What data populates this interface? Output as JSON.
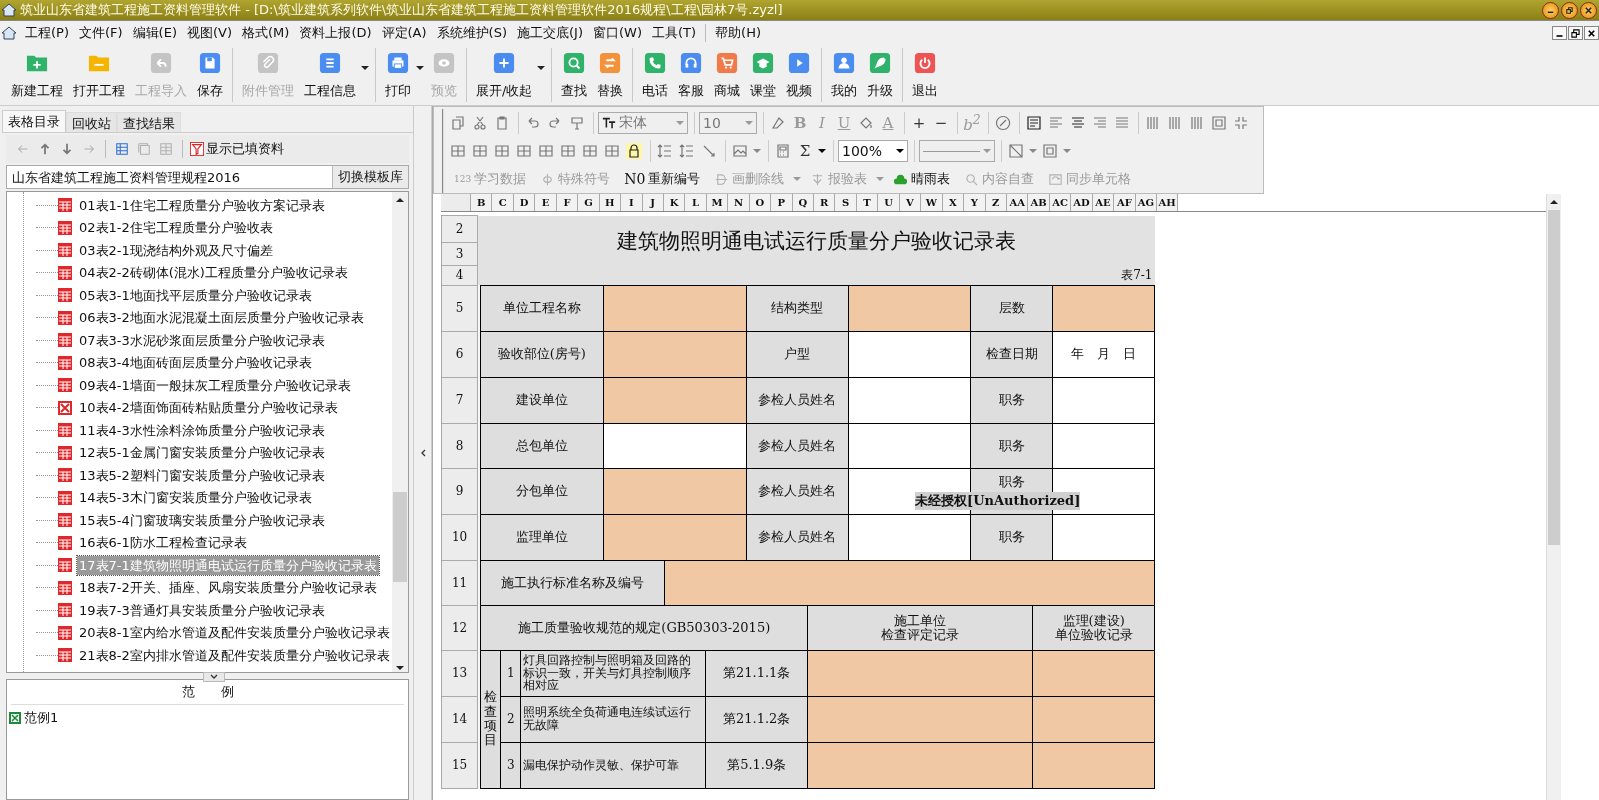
{
  "window": {
    "title": "筑业山东省建筑工程施工资料管理软件 - [D:\\筑业建筑系列软件\\筑业山东省建筑工程施工资料管理软件2016规程\\工程\\园林7号.zyzl]"
  },
  "menu": [
    "工程(P)",
    "文件(F)",
    "编辑(E)",
    "视图(V)",
    "格式(M)",
    "资料上报(D)",
    "评定(A)",
    "系统维护(S)",
    "施工交底(J)",
    "窗口(W)",
    "工具(T)"
  ],
  "help_menu": "帮助(H)",
  "toolbar": [
    [
      {
        "label": "新建工程",
        "kind": "new",
        "disabled": false,
        "dropdown": false
      },
      {
        "label": "打开工程",
        "kind": "open",
        "disabled": false,
        "dropdown": false
      },
      {
        "label": "工程导入",
        "kind": "import",
        "disabled": true,
        "dropdown": false
      },
      {
        "label": "保存",
        "kind": "save",
        "disabled": false,
        "dropdown": false
      }
    ],
    [
      {
        "label": "附件管理",
        "kind": "attach",
        "disabled": true,
        "dropdown": false
      },
      {
        "label": "工程信息",
        "kind": "info",
        "disabled": false,
        "dropdown": true
      }
    ],
    [
      {
        "label": "打印",
        "kind": "print",
        "disabled": false,
        "dropdown": true
      },
      {
        "label": "预览",
        "kind": "preview",
        "disabled": true,
        "dropdown": false
      }
    ],
    [
      {
        "label": "展开/收起",
        "kind": "expand",
        "disabled": false,
        "dropdown": true
      }
    ],
    [
      {
        "label": "查找",
        "kind": "find",
        "disabled": false,
        "dropdown": false
      },
      {
        "label": "替换",
        "kind": "replace",
        "disabled": false,
        "dropdown": false
      }
    ],
    [
      {
        "label": "电话",
        "kind": "phone",
        "disabled": false,
        "dropdown": false
      },
      {
        "label": "客服",
        "kind": "service",
        "disabled": false,
        "dropdown": false
      },
      {
        "label": "商城",
        "kind": "shop",
        "disabled": false,
        "dropdown": false
      },
      {
        "label": "课堂",
        "kind": "class",
        "disabled": false,
        "dropdown": false
      },
      {
        "label": "视频",
        "kind": "video",
        "disabled": false,
        "dropdown": false
      }
    ],
    [
      {
        "label": "我的",
        "kind": "me",
        "disabled": false,
        "dropdown": false
      },
      {
        "label": "升级",
        "kind": "upgrade",
        "disabled": false,
        "dropdown": false
      }
    ],
    [
      {
        "label": "退出",
        "kind": "exit",
        "disabled": false,
        "dropdown": false
      }
    ]
  ],
  "left_panel": {
    "tabs": [
      {
        "label": "表格目录",
        "selected": true
      },
      {
        "label": "回收站",
        "selected": false
      },
      {
        "label": "查找结果",
        "selected": false
      }
    ],
    "tree_toolbar": [
      {
        "disabled": true
      },
      {
        "disabled": false
      },
      {
        "disabled": false
      },
      {
        "disabled": true
      },
      {
        "disabled": false
      },
      {
        "disabled": true
      },
      {
        "disabled": true
      }
    ],
    "filter_button": "显示已填资料",
    "library": "山东省建筑工程施工资料管理规程2016",
    "switch_button": "切换模板库",
    "tree": [
      {
        "label": "01表1-1住宅工程质量分户验收方案记录表",
        "kind": "table",
        "selected": false
      },
      {
        "label": "02表1-2住宅工程质量分户验收表",
        "kind": "table",
        "selected": false
      },
      {
        "label": "03表2-1现浇结构外观及尺寸偏差",
        "kind": "table",
        "selected": false
      },
      {
        "label": "04表2-2砖砌体(混水)工程质量分户验收记录表",
        "kind": "table",
        "selected": false
      },
      {
        "label": "05表3-1地面找平层质量分户验收记录表",
        "kind": "table",
        "selected": false
      },
      {
        "label": "06表3-2地面水泥混凝土面层质量分户验收记录表",
        "kind": "table",
        "selected": false
      },
      {
        "label": "07表3-3水泥砂浆面层质量分户验收记录表",
        "kind": "table",
        "selected": false
      },
      {
        "label": "08表3-4地面砖面层质量分户验收记录表",
        "kind": "table",
        "selected": false
      },
      {
        "label": "09表4-1墙面一般抹灰工程质量分户验收记录表",
        "kind": "table",
        "selected": false
      },
      {
        "label": "10表4-2墙面饰面砖粘贴质量分户验收记录表",
        "kind": "error",
        "selected": false
      },
      {
        "label": "11表4-3水性涂料涂饰质量分户验收记录表",
        "kind": "table",
        "selected": false
      },
      {
        "label": "12表5-1金属门窗安装质量分户验收记录表",
        "kind": "table",
        "selected": false
      },
      {
        "label": "13表5-2塑料门窗安装质量分户验收记录表",
        "kind": "table",
        "selected": false
      },
      {
        "label": "14表5-3木门窗安装质量分户验收记录表",
        "kind": "table",
        "selected": false
      },
      {
        "label": "15表5-4门窗玻璃安装质量分户验收记录表",
        "kind": "table",
        "selected": false
      },
      {
        "label": "16表6-1防水工程检查记录表",
        "kind": "table",
        "selected": false
      },
      {
        "label": "17表7-1建筑物照明通电试运行质量分户验收记录表",
        "kind": "table",
        "selected": true
      },
      {
        "label": "18表7-2开关、插座、风扇安装质量分户验收记录表",
        "kind": "table",
        "selected": false
      },
      {
        "label": "19表7-3普通灯具安装质量分户验收记录表",
        "kind": "table",
        "selected": false
      },
      {
        "label": "20表8-1室内给水管道及配件安装质量分户验收记录表",
        "kind": "table",
        "selected": false
      },
      {
        "label": "21表8-2室内排水管道及配件安装质量分户验收记录表",
        "kind": "table",
        "selected": false
      }
    ],
    "example_header": "范　　例",
    "examples": [
      "范例1"
    ]
  },
  "format_toolbar": {
    "font": {
      "value": "宋体",
      "disabled": true
    },
    "size": {
      "value": "10",
      "disabled": true
    },
    "text_style": [
      {
        "text": "B",
        "disabled": true
      },
      {
        "text": "I",
        "disabled": true
      },
      {
        "text": "U",
        "disabled": true
      },
      {
        "text": "A",
        "disabled": true
      }
    ],
    "resize": [
      {
        "text": "+",
        "disabled": false
      },
      {
        "text": "−",
        "disabled": false
      }
    ],
    "superscript": {
      "text": "b$^{2}$",
      "disabled": true
    },
    "sum": {
      "text": "Σ",
      "disabled": false
    },
    "zoom": {
      "value": "100%",
      "disabled": false
    },
    "line_style": {
      "disabled": true
    },
    "tools": [
      {
        "label": "学习数据",
        "kind": "prefix",
        "prefix": "123",
        "disabled": true,
        "dropdown": false
      },
      {
        "label": "特殊符号",
        "kind": "icon",
        "disabled": true,
        "dropdown": false
      },
      {
        "label": "重新编号",
        "kind": "prefix",
        "prefix": "N0",
        "disabled": false,
        "dropdown": false
      },
      {
        "label": "画删除线",
        "kind": "icon",
        "disabled": true,
        "dropdown": true
      },
      {
        "label": "报验表",
        "kind": "icon",
        "disabled": true,
        "dropdown": true
      },
      {
        "label": "晴雨表",
        "kind": "icon",
        "disabled": false,
        "dropdown": false
      },
      {
        "label": "内容自查",
        "kind": "icon",
        "disabled": true,
        "dropdown": false
      },
      {
        "label": "同步单元格",
        "kind": "icon",
        "disabled": true,
        "dropdown": false
      }
    ]
  },
  "sheet": {
    "columns": [
      "B",
      "C",
      "D",
      "E",
      "F",
      "G",
      "H",
      "I",
      "J",
      "K",
      "L",
      "M",
      "N",
      "O",
      "P",
      "Q",
      "R",
      "S",
      "T",
      "U",
      "V",
      "W",
      "X",
      "Y",
      "Z",
      "AA",
      "AB",
      "AC",
      "AD",
      "AE",
      "AF",
      "AG",
      "AH"
    ],
    "rows": [
      "2",
      "3",
      "4",
      "5",
      "6",
      "7",
      "8",
      "9",
      "10",
      "11",
      "12",
      "13",
      "14",
      "15"
    ],
    "title": "建筑物照明通电试运行质量分户验收记录表",
    "form_no": "表7-1",
    "info_rows": [
      [
        {
          "text": "单位工程名称",
          "kind": "label"
        },
        {
          "kind": "input"
        },
        {
          "text": "结构类型",
          "kind": "label"
        },
        {
          "kind": "input"
        },
        {
          "text": "层数",
          "kind": "label"
        },
        {
          "kind": "input"
        }
      ],
      [
        {
          "text": "验收部位(房号)",
          "kind": "label"
        },
        {
          "kind": "input"
        },
        {
          "text": "户型",
          "kind": "label"
        },
        {
          "kind": "blank"
        },
        {
          "text": "检查日期",
          "kind": "label"
        },
        {
          "text": "年　月　日",
          "kind": "blank"
        }
      ],
      [
        {
          "text": "建设单位",
          "kind": "label"
        },
        {
          "kind": "input"
        },
        {
          "text": "参检人员姓名",
          "kind": "label"
        },
        {
          "kind": "blank"
        },
        {
          "text": "职务",
          "kind": "label"
        },
        {
          "kind": "blank"
        }
      ],
      [
        {
          "text": "总包单位",
          "kind": "label"
        },
        {
          "kind": "blank"
        },
        {
          "text": "参检人员姓名",
          "kind": "label"
        },
        {
          "kind": "blank"
        },
        {
          "text": "职务",
          "kind": "label"
        },
        {
          "kind": "blank"
        }
      ],
      [
        {
          "text": "分包单位",
          "kind": "label"
        },
        {
          "kind": "input"
        },
        {
          "text": "参检人员姓名",
          "kind": "label"
        },
        {
          "kind": "blank"
        },
        {
          "text": "职务",
          "kind": "label"
        },
        {
          "kind": "blank"
        }
      ],
      [
        {
          "text": "监理单位",
          "kind": "label"
        },
        {
          "kind": "input"
        },
        {
          "text": "参检人员姓名",
          "kind": "label"
        },
        {
          "kind": "blank"
        },
        {
          "text": "职务",
          "kind": "label"
        },
        {
          "kind": "blank"
        }
      ]
    ],
    "standard": "施工执行标准名称及编号",
    "header": [
      "施工质量验收规范的规定(GB50303-2015)",
      [
        "施工单位",
        "检查评定记录"
      ],
      [
        "监理(建设)",
        "单位验收记录"
      ]
    ],
    "group": "检查项目",
    "items": [
      {
        "no": "1",
        "text": "灯具回路控制与照明箱及回路的标识一致，开关与灯具控制顺序相对应",
        "clause": "第21.1.1条"
      },
      {
        "no": "2",
        "text": "照明系统全负荷通电连续试运行无故障",
        "clause": "第21.1.2条"
      },
      {
        "no": "3",
        "text": "漏电保护动作灵敏、保护可靠",
        "clause": "第5.1.9条"
      }
    ],
    "overlay": "未经授权[UnAuthorized]"
  }
}
